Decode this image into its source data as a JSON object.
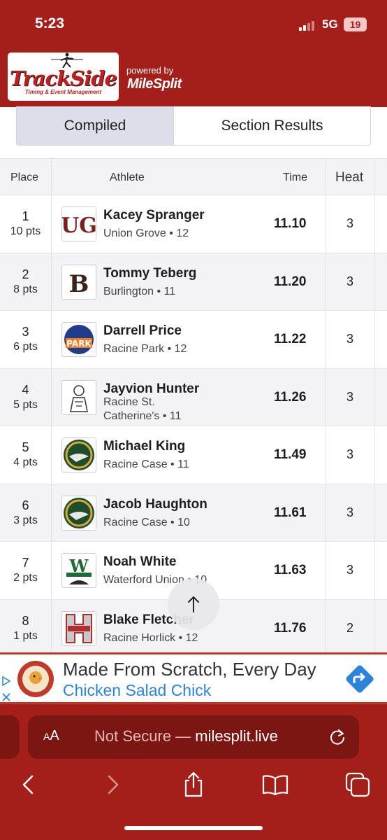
{
  "status": {
    "time": "5:23",
    "network": "5G",
    "battery": "19"
  },
  "header": {
    "logo_text": "TrackSide",
    "logo_sub": "Timing & Event Management",
    "powered_by": "powered by",
    "brand": "MileSplit"
  },
  "tabs": [
    {
      "label": "Compiled",
      "active": true
    },
    {
      "label": "Section Results",
      "active": false
    }
  ],
  "table": {
    "columns": {
      "place": "Place",
      "athlete": "Athlete",
      "time": "Time",
      "heat": "Heat"
    },
    "rows": [
      {
        "place": "1",
        "pts": "10 pts",
        "name": "Kacey Spranger",
        "school": "Union Grove • 12",
        "time": "11.10",
        "heat": "3"
      },
      {
        "place": "2",
        "pts": "8 pts",
        "name": "Tommy Teberg",
        "school": "Burlington • 11",
        "time": "11.20",
        "heat": "3"
      },
      {
        "place": "3",
        "pts": "6 pts",
        "name": "Darrell Price",
        "school": "Racine Park • 12",
        "time": "11.22",
        "heat": "3"
      },
      {
        "place": "4",
        "pts": "5 pts",
        "name": "Jayvion Hunter",
        "school_line1": "Racine St.",
        "school_line2": "Catherine's • 11",
        "time": "11.26",
        "heat": "3"
      },
      {
        "place": "5",
        "pts": "4 pts",
        "name": "Michael King",
        "school": "Racine Case • 11",
        "time": "11.49",
        "heat": "3"
      },
      {
        "place": "6",
        "pts": "3 pts",
        "name": "Jacob Haughton",
        "school": "Racine Case • 10",
        "time": "11.61",
        "heat": "3"
      },
      {
        "place": "7",
        "pts": "2 pts",
        "name": "Noah White",
        "school": "Waterford Union • 10",
        "time": "11.63",
        "heat": "3"
      },
      {
        "place": "8",
        "pts": "1 pts",
        "name": "Blake Fletcher",
        "school": "Racine Horlick • 12",
        "time": "11.76",
        "heat": "2"
      }
    ]
  },
  "scroll_top_icon": "arrow-up-icon",
  "ad": {
    "headline": "Made From Scratch, Every Day",
    "brand": "Chicken Salad Chick"
  },
  "browser": {
    "text_size": "AA",
    "url_prefix": "Not Secure — ",
    "url_domain": "milesplit.live"
  },
  "colors": {
    "brand_red": "#a51f1a",
    "dark_red": "#7b1612",
    "tab_active": "#dcdfea",
    "ad_blue": "#2b84d8"
  }
}
